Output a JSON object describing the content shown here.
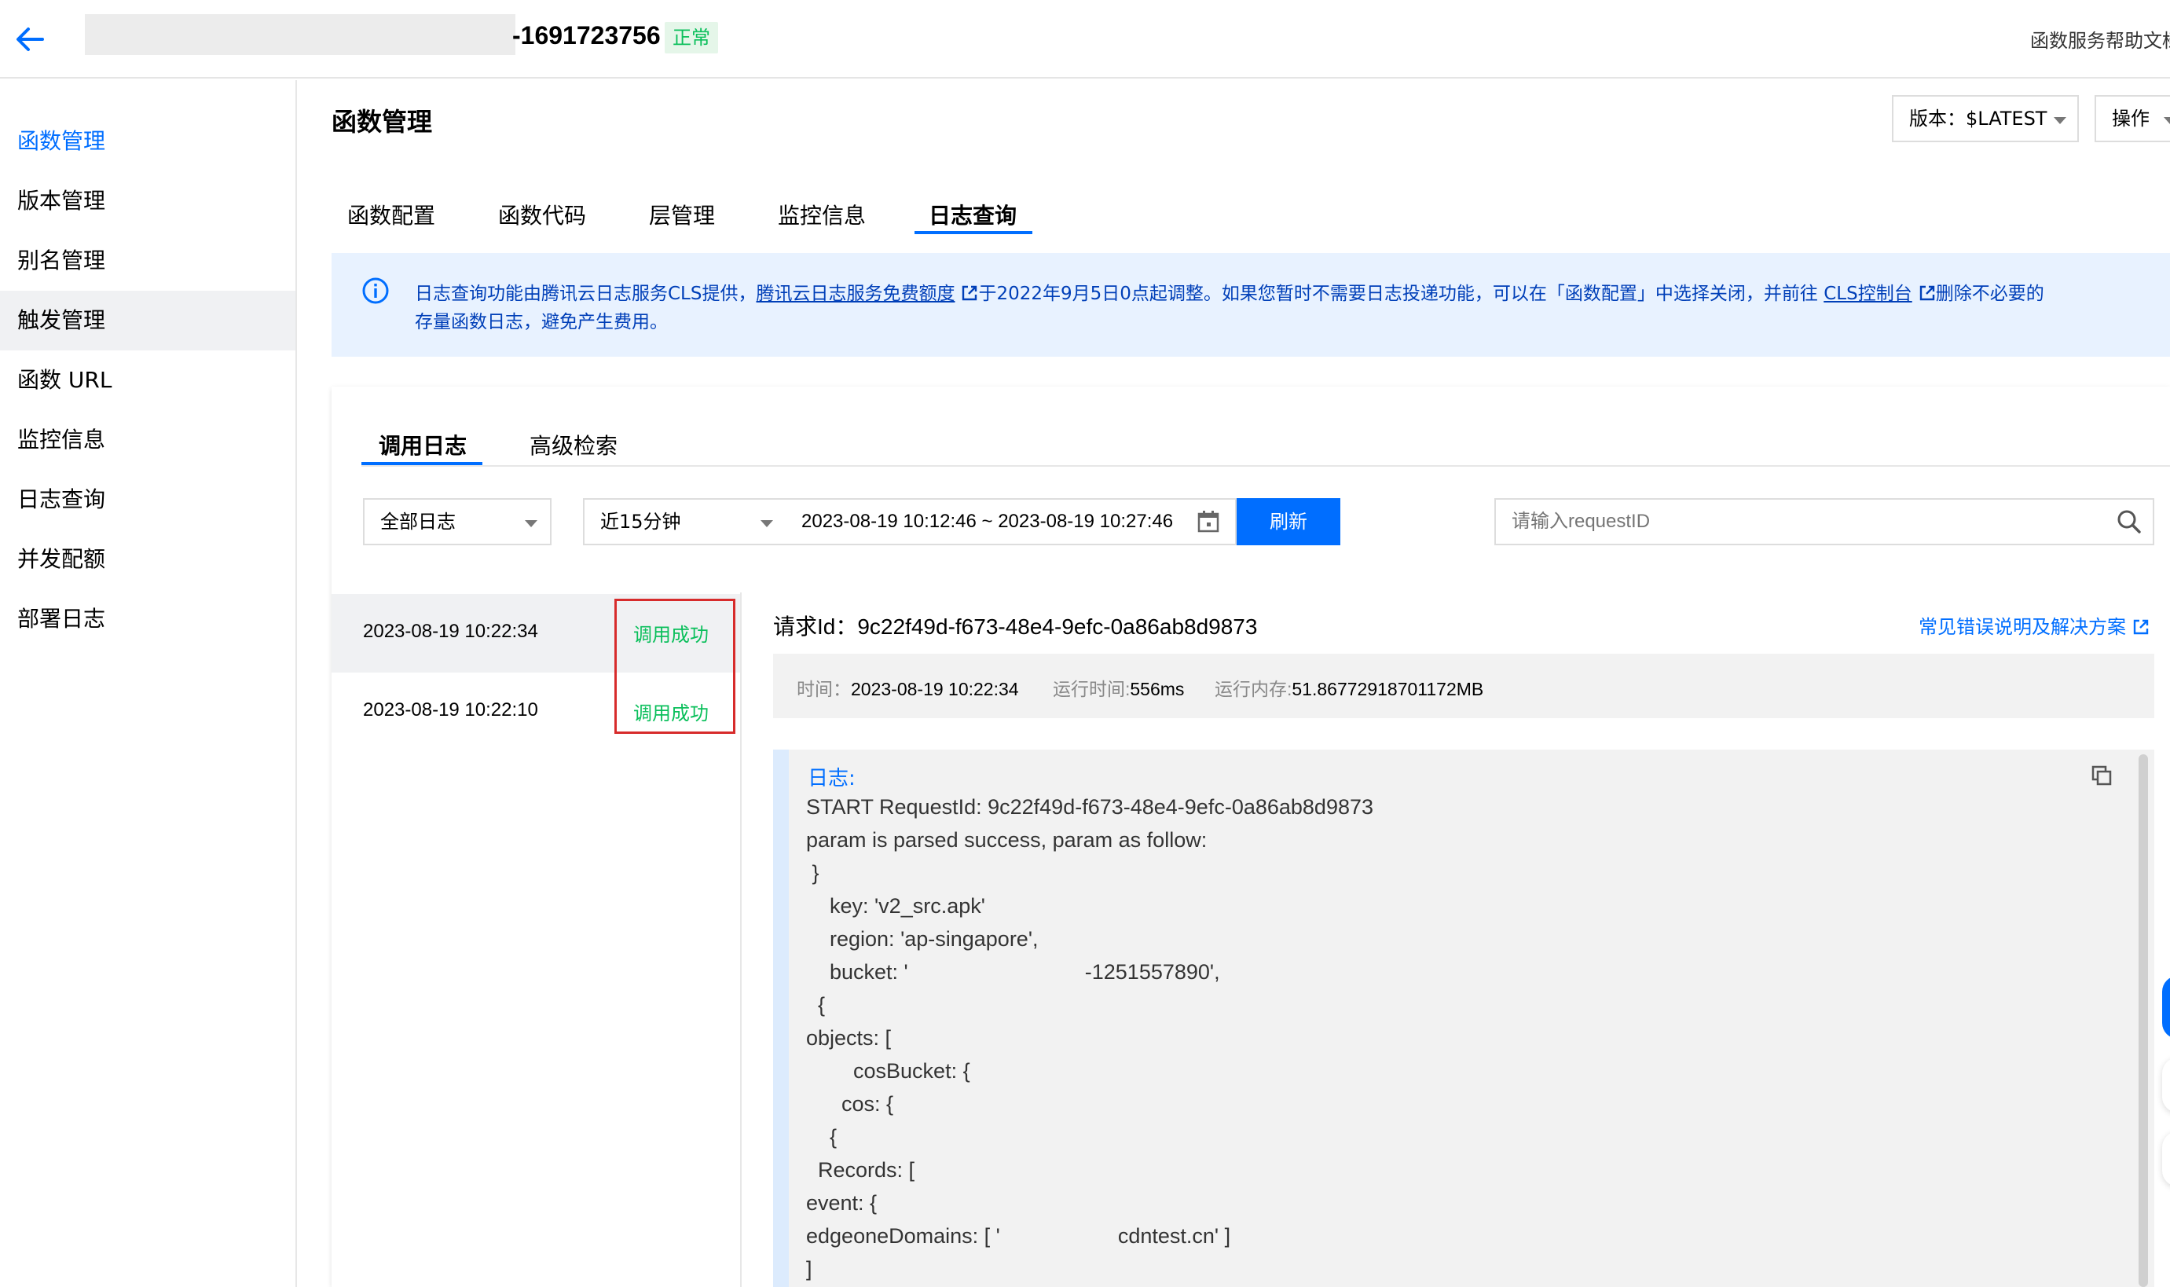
{
  "header": {
    "function_id_suffix": "-1691723756",
    "status_badge": "正常",
    "help_link": "函数服务帮助文档"
  },
  "sidebar": {
    "items": [
      {
        "label": "函数管理"
      },
      {
        "label": "版本管理"
      },
      {
        "label": "别名管理"
      },
      {
        "label": "触发管理"
      },
      {
        "label": "函数 URL"
      },
      {
        "label": "监控信息"
      },
      {
        "label": "日志查询"
      },
      {
        "label": "并发配额"
      },
      {
        "label": "部署日志"
      }
    ]
  },
  "page": {
    "title": "函数管理",
    "version_select": "版本：$LATEST",
    "op_select": "操作"
  },
  "tabs": [
    {
      "label": "函数配置"
    },
    {
      "label": "函数代码"
    },
    {
      "label": "层管理"
    },
    {
      "label": "监控信息"
    },
    {
      "label": "日志查询"
    }
  ],
  "notice": {
    "part1": "日志查询功能由腾讯云日志服务CLS提供，",
    "link1": "腾讯云日志服务免费额度",
    "part2": "于2022年9月5日0点起调整。如果您暂时不需要日志投递功能，可以在「函数配置」中选择关闭，并前往",
    "link2": "CLS控制台",
    "part3": "删除不必要的",
    "line2": "存量函数日志，避免产生费用。"
  },
  "sub_tabs": [
    {
      "label": "调用日志"
    },
    {
      "label": "高级检索"
    }
  ],
  "filters": {
    "log_type": "全部日志",
    "time_preset": "近15分钟",
    "date_range": "2023-08-19 10:12:46 ~ 2023-08-19 10:27:46",
    "refresh_label": "刷新",
    "search_placeholder": "请输入requestID"
  },
  "invocations": [
    {
      "time": "2023-08-19 10:22:34",
      "status": "调用成功"
    },
    {
      "time": "2023-08-19 10:22:10",
      "status": "调用成功"
    }
  ],
  "detail": {
    "request_id_label": "请求Id：",
    "request_id": "9c22f49d-f673-48e4-9efc-0a86ab8d9873",
    "faq_link": "常见错误说明及解决方案",
    "time_label": "时间：",
    "time_value": "2023-08-19 10:22:34",
    "duration_label": "运行时间:",
    "duration_value": "556ms",
    "memory_label": "运行内存:",
    "memory_value": "51.86772918701172MB"
  },
  "log": {
    "heading": "日志:",
    "lines": [
      "START RequestId: 9c22f49d-f673-48e4-9efc-0a86ab8d9873",
      "param is parsed success, param as follow:",
      " }",
      "    key: 'v2_src.apk'",
      "    region: 'ap-singapore',",
      "    bucket: '                              -1251557890',",
      "  {",
      "objects: [",
      "        cosBucket: {",
      "      cos: {",
      "    {",
      "  Records: [",
      "event: {",
      "edgeoneDomains: [ '                    cdntest.cn' ]",
      "]"
    ]
  },
  "colors": {
    "accent": "#006eff",
    "success": "#0abf5b",
    "highlight_box": "#d72b2b"
  }
}
